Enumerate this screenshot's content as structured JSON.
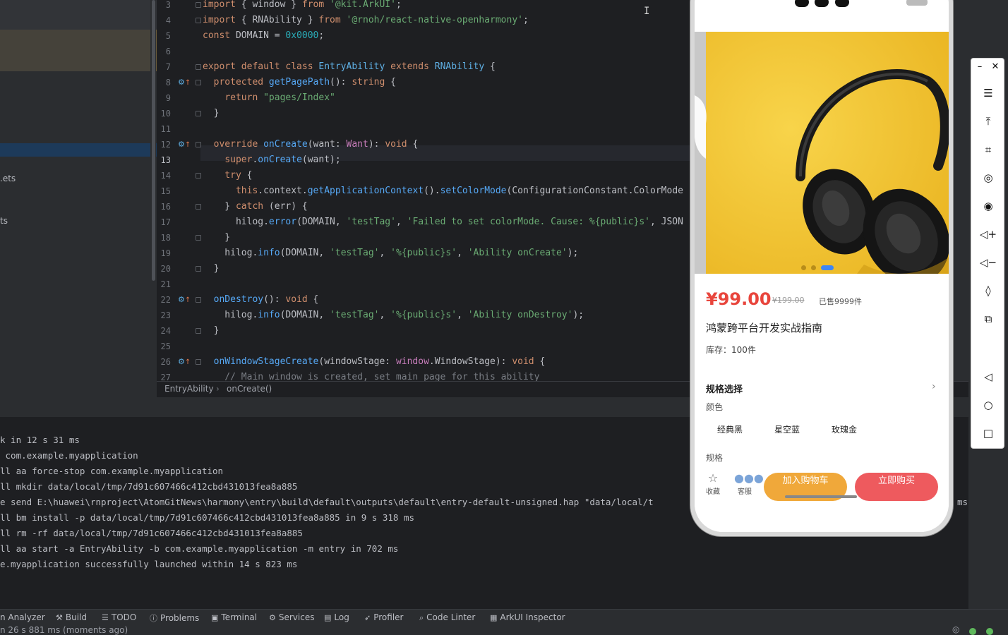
{
  "project": {
    "files": [
      {
        "label": ".ets"
      },
      {
        "label": "ts"
      }
    ]
  },
  "editor": {
    "lines": [
      {
        "num": "3",
        "tokens": [
          [
            "kw",
            "import"
          ],
          [
            "plain",
            " { window } "
          ],
          [
            "kw",
            "from"
          ],
          [
            "str",
            " '@kit.ArkUI'"
          ],
          [
            "plain",
            ";"
          ]
        ]
      },
      {
        "num": "4",
        "tokens": [
          [
            "kw",
            "import"
          ],
          [
            "plain",
            " { RNAbility } "
          ],
          [
            "kw",
            "from"
          ],
          [
            "str",
            " '@rnoh/react-native-openharmony'"
          ],
          [
            "plain",
            ";"
          ]
        ]
      },
      {
        "num": "5",
        "tokens": [
          [
            "kw",
            "const"
          ],
          [
            "plain",
            " DOMAIN = "
          ],
          [
            "num",
            "0x0000"
          ],
          [
            "plain",
            ";"
          ]
        ]
      },
      {
        "num": "6",
        "tokens": []
      },
      {
        "num": "7",
        "tokens": [
          [
            "kw",
            "export default class"
          ],
          [
            "cls",
            " EntryAbility"
          ],
          [
            "kw",
            " extends"
          ],
          [
            "cls",
            " RNAbility"
          ],
          [
            "plain",
            " {"
          ]
        ]
      },
      {
        "num": "8",
        "tokens": [
          [
            "plain",
            "  "
          ],
          [
            "kw",
            "protected"
          ],
          [
            "fn",
            " getPagePath"
          ],
          [
            "plain",
            "(): "
          ],
          [
            "kw",
            "string"
          ],
          [
            "plain",
            " {"
          ]
        ]
      },
      {
        "num": "9",
        "tokens": [
          [
            "plain",
            "    "
          ],
          [
            "kw",
            "return"
          ],
          [
            "str",
            " \"pages/Index\""
          ]
        ]
      },
      {
        "num": "10",
        "tokens": [
          [
            "plain",
            "  }"
          ]
        ]
      },
      {
        "num": "11",
        "tokens": []
      },
      {
        "num": "12",
        "tokens": [
          [
            "plain",
            "  "
          ],
          [
            "kw",
            "override"
          ],
          [
            "fn",
            " onCreate"
          ],
          [
            "plain",
            "(want: "
          ],
          [
            "typ",
            "Want"
          ],
          [
            "plain",
            "): "
          ],
          [
            "kw",
            "void"
          ],
          [
            "plain",
            " {"
          ]
        ]
      },
      {
        "num": "13",
        "tokens": [
          [
            "plain",
            "    "
          ],
          [
            "kw",
            "super"
          ],
          [
            "plain",
            "."
          ],
          [
            "fn",
            "onCreate"
          ],
          [
            "plain",
            "(want);"
          ]
        ]
      },
      {
        "num": "14",
        "tokens": [
          [
            "plain",
            "    "
          ],
          [
            "kw",
            "try"
          ],
          [
            "plain",
            " {"
          ]
        ]
      },
      {
        "num": "15",
        "tokens": [
          [
            "plain",
            "      "
          ],
          [
            "kw",
            "this"
          ],
          [
            "plain",
            ".context."
          ],
          [
            "fn",
            "getApplicationContext"
          ],
          [
            "plain",
            "()."
          ],
          [
            "fn",
            "setColorMode"
          ],
          [
            "plain",
            "(ConfigurationConstant.ColorMode"
          ]
        ]
      },
      {
        "num": "16",
        "tokens": [
          [
            "plain",
            "    } "
          ],
          [
            "kw",
            "catch"
          ],
          [
            "plain",
            " (err) {"
          ]
        ]
      },
      {
        "num": "17",
        "tokens": [
          [
            "plain",
            "      hilog."
          ],
          [
            "fn",
            "error"
          ],
          [
            "plain",
            "(DOMAIN, "
          ],
          [
            "str",
            "'testTag'"
          ],
          [
            "plain",
            ", "
          ],
          [
            "str",
            "'Failed to set colorMode. Cause: %{public}s'"
          ],
          [
            "plain",
            ", JSON"
          ]
        ]
      },
      {
        "num": "18",
        "tokens": [
          [
            "plain",
            "    }"
          ]
        ]
      },
      {
        "num": "19",
        "tokens": [
          [
            "plain",
            "    hilog."
          ],
          [
            "fn",
            "info"
          ],
          [
            "plain",
            "(DOMAIN, "
          ],
          [
            "str",
            "'testTag'"
          ],
          [
            "plain",
            ", "
          ],
          [
            "str",
            "'%{public}s'"
          ],
          [
            "plain",
            ", "
          ],
          [
            "str",
            "'Ability onCreate'"
          ],
          [
            "plain",
            ");"
          ]
        ]
      },
      {
        "num": "20",
        "tokens": [
          [
            "plain",
            "  }"
          ]
        ]
      },
      {
        "num": "21",
        "tokens": []
      },
      {
        "num": "22",
        "tokens": [
          [
            "plain",
            "  "
          ],
          [
            "fn",
            "onDestroy"
          ],
          [
            "plain",
            "(): "
          ],
          [
            "kw",
            "void"
          ],
          [
            "plain",
            " {"
          ]
        ]
      },
      {
        "num": "23",
        "tokens": [
          [
            "plain",
            "    hilog."
          ],
          [
            "fn",
            "info"
          ],
          [
            "plain",
            "(DOMAIN, "
          ],
          [
            "str",
            "'testTag'"
          ],
          [
            "plain",
            ", "
          ],
          [
            "str",
            "'%{public}s'"
          ],
          [
            "plain",
            ", "
          ],
          [
            "str",
            "'Ability onDestroy'"
          ],
          [
            "plain",
            ");"
          ]
        ]
      },
      {
        "num": "24",
        "tokens": [
          [
            "plain",
            "  }"
          ]
        ]
      },
      {
        "num": "25",
        "tokens": []
      },
      {
        "num": "26",
        "tokens": [
          [
            "plain",
            "  "
          ],
          [
            "fn",
            "onWindowStageCreate"
          ],
          [
            "plain",
            "(windowStage: "
          ],
          [
            "typ",
            "window"
          ],
          [
            "plain",
            ".WindowStage): "
          ],
          [
            "kw",
            "void"
          ],
          [
            "plain",
            " {"
          ]
        ]
      },
      {
        "num": "27",
        "tokens": [
          [
            "cmt",
            "    // Main window is created, set main page for this ability"
          ]
        ]
      }
    ],
    "current_line": "13"
  },
  "breadcrumb": {
    "class": "EntryAbility",
    "method": "onCreate()"
  },
  "console": {
    "lines": [
      "k in 12 s 31 ms",
      " com.example.myapplication",
      "ll aa force-stop com.example.myapplication",
      "ll mkdir data/local/tmp/7d91c607466c412cbd431013fea8a885",
      "e send E:\\huawei\\rnproject\\AtomGitNews\\harmony\\entry\\build\\default\\outputs\\default\\entry-default-unsigned.hap \"data/local/t",
      "ll bm install -p data/local/tmp/7d91c607466c412cbd431013fea8a885 in 9 s 318 ms",
      "ll rm -rf data/local/tmp/7d91c607466c412cbd431013fea8a885",
      "ll aa start -a EntryAbility -b com.example.myapplication -m entry in 702 ms",
      "e.myapplication successfully launched within 14 s 823 ms"
    ],
    "overflow_suffix": "ms"
  },
  "toolbar": {
    "items": [
      {
        "icon": "analyzer-icon",
        "label": "n Analyzer"
      },
      {
        "icon": "build-icon",
        "glyph": "⚒",
        "label": "Build"
      },
      {
        "icon": "todo-icon",
        "glyph": "☰",
        "label": "TODO"
      },
      {
        "icon": "problems-icon",
        "glyph": "ⓘ",
        "label": "Problems"
      },
      {
        "icon": "terminal-icon",
        "glyph": "▣",
        "label": "Terminal"
      },
      {
        "icon": "services-icon",
        "glyph": "⚙",
        "label": "Services"
      },
      {
        "icon": "log-icon",
        "glyph": "▤",
        "label": "Log"
      },
      {
        "icon": "profiler-icon",
        "glyph": "➶",
        "label": "Profiler"
      },
      {
        "icon": "code-linter-icon",
        "glyph": "⌕",
        "label": "Code Linter"
      },
      {
        "icon": "arkui-inspector-icon",
        "glyph": "▦",
        "label": "ArkUI Inspector"
      }
    ]
  },
  "status": {
    "text": "n 26 s 881 ms (moments ago)"
  },
  "phone": {
    "price": "¥99.00",
    "original_price": "¥199.00",
    "sold": "已售9999件",
    "title": "鸿蒙跨平台开发实战指南",
    "stock": "库存：100件",
    "spec_title": "规格选择",
    "color_label": "颜色",
    "colors": [
      "经典黑",
      "星空蓝",
      "玫瑰金"
    ],
    "size_label": "规格",
    "favorite_label": "收藏",
    "service_label": "客服",
    "add_to_cart": "加入购物车",
    "buy_now": "立即购买",
    "carousel": {
      "count": 3,
      "active_index": 3
    },
    "colors_theme": {
      "price": "#e8453c",
      "cart": "#f0a83a",
      "buy": "#ee5a5e",
      "hero_bg": "#f2c22c"
    }
  },
  "emulator_tools": [
    {
      "name": "minimize-icon",
      "glyph": "–"
    },
    {
      "name": "close-icon",
      "glyph": "✕"
    },
    {
      "name": "menu-icon",
      "glyph": "☰"
    },
    {
      "name": "pin-top-icon",
      "glyph": "⤒"
    },
    {
      "name": "crop-icon",
      "glyph": "⌗"
    },
    {
      "name": "rotate-icon",
      "glyph": "◎"
    },
    {
      "name": "screenshot-icon",
      "glyph": "◉"
    },
    {
      "name": "volume-up-icon",
      "glyph": "◁+"
    },
    {
      "name": "volume-down-icon",
      "glyph": "◁−"
    },
    {
      "name": "shake-icon",
      "glyph": "◊"
    },
    {
      "name": "copy-icon",
      "glyph": "⧉"
    },
    {
      "name": "back-icon",
      "glyph": "◁"
    },
    {
      "name": "home-icon",
      "glyph": "○"
    },
    {
      "name": "recents-icon",
      "glyph": "□"
    }
  ]
}
